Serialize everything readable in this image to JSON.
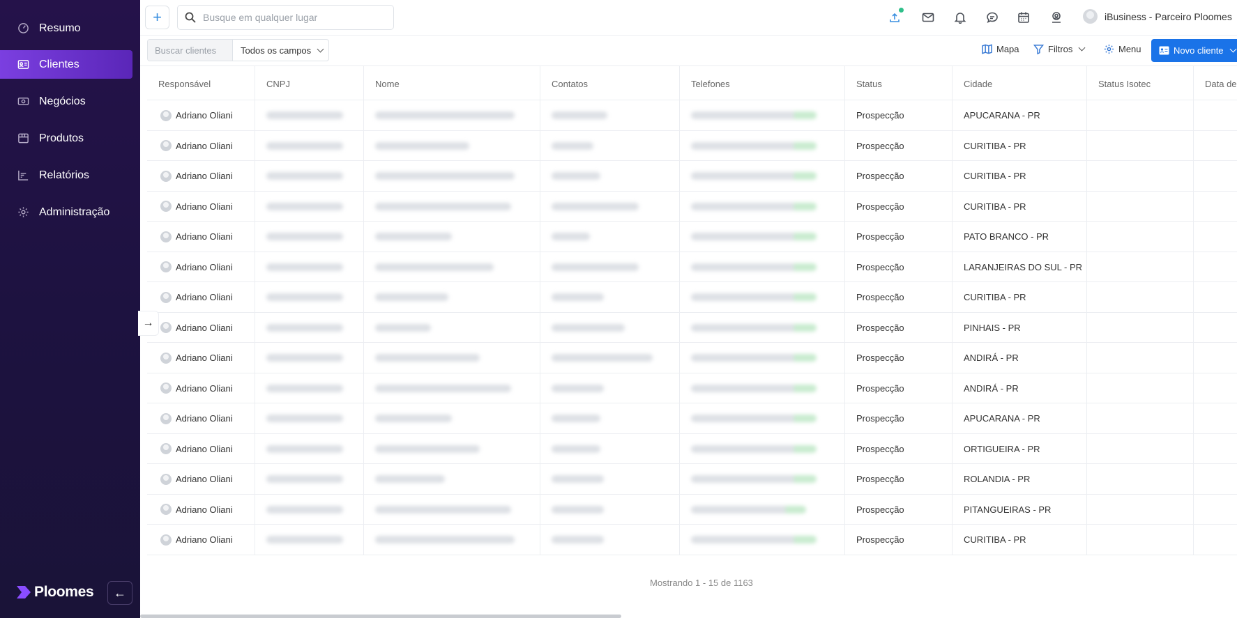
{
  "sidebar": {
    "items": [
      {
        "label": "Resumo",
        "icon": "dashboard-icon"
      },
      {
        "label": "Clientes",
        "icon": "id-card-icon",
        "active": true
      },
      {
        "label": "Negócios",
        "icon": "money-icon"
      },
      {
        "label": "Produtos",
        "icon": "box-icon"
      },
      {
        "label": "Relatórios",
        "icon": "report-icon"
      },
      {
        "label": "Administração",
        "icon": "gear-icon"
      }
    ],
    "logo": "Ploomes",
    "collapse_icon": "←"
  },
  "topbar": {
    "search_placeholder": "Busque em qualquer lugar",
    "add_icon": "+",
    "account_name": "iBusiness - Parceiro Ploomes"
  },
  "toolbar": {
    "client_search_placeholder": "Buscar clientes",
    "field_filter": "Todos os campos",
    "map_label": "Mapa",
    "filters_label": "Filtros",
    "menu_label": "Menu",
    "new_client_label": "Novo cliente"
  },
  "table": {
    "columns": [
      "Responsável",
      "CNPJ",
      "Nome",
      "Contatos",
      "Telefones",
      "Status",
      "Cidade",
      "Status Isotec",
      "Data de"
    ],
    "rows": [
      {
        "responsavel": "Adriano Oliani",
        "status": "Prospecção",
        "cidade": "APUCARANA - PR"
      },
      {
        "responsavel": "Adriano Oliani",
        "status": "Prospecção",
        "cidade": "CURITIBA - PR"
      },
      {
        "responsavel": "Adriano Oliani",
        "status": "Prospecção",
        "cidade": "CURITIBA - PR"
      },
      {
        "responsavel": "Adriano Oliani",
        "status": "Prospecção",
        "cidade": "CURITIBA - PR"
      },
      {
        "responsavel": "Adriano Oliani",
        "status": "Prospecção",
        "cidade": "PATO BRANCO - PR"
      },
      {
        "responsavel": "Adriano Oliani",
        "status": "Prospecção",
        "cidade": "LARANJEIRAS DO SUL - PR"
      },
      {
        "responsavel": "Adriano Oliani",
        "status": "Prospecção",
        "cidade": "CURITIBA - PR"
      },
      {
        "responsavel": "Adriano Oliani",
        "status": "Prospecção",
        "cidade": "PINHAIS - PR"
      },
      {
        "responsavel": "Adriano Oliani",
        "status": "Prospecção",
        "cidade": "ANDIRÁ - PR"
      },
      {
        "responsavel": "Adriano Oliani",
        "status": "Prospecção",
        "cidade": "ANDIRÁ - PR"
      },
      {
        "responsavel": "Adriano Oliani",
        "status": "Prospecção",
        "cidade": "APUCARANA - PR"
      },
      {
        "responsavel": "Adriano Oliani",
        "status": "Prospecção",
        "cidade": "ORTIGUEIRA - PR"
      },
      {
        "responsavel": "Adriano Oliani",
        "status": "Prospecção",
        "cidade": "ROLANDIA - PR"
      },
      {
        "responsavel": "Adriano Oliani",
        "status": "Prospecção",
        "cidade": "PITANGUEIRAS - PR"
      },
      {
        "responsavel": "Adriano Oliani",
        "status": "Prospecção",
        "cidade": "CURITIBA - PR"
      }
    ],
    "pagination": "Mostrando 1 - 15 de 1163"
  },
  "colors": {
    "sidebar_bg": "#1d1240",
    "active_nav": "#7b3fe0",
    "primary_button": "#1a73e8",
    "notification_dot": "#2fbf8a"
  }
}
